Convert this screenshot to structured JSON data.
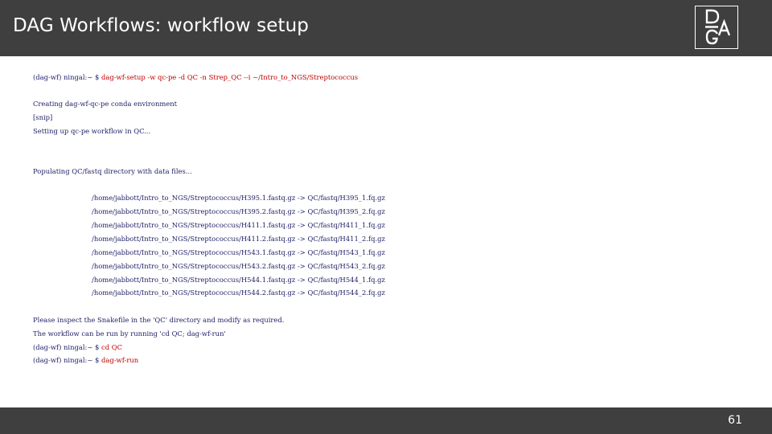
{
  "header": {
    "title": "DAG Workflows: workflow setup",
    "logo_text": "DAG"
  },
  "terminal": {
    "prompt1": "(dag-wf) ningal:~ $",
    "command1": "dag-wf-setup -w qc-pe -d QC -n Strep_QC --i ~/Intro_to_NGS/Streptococcus",
    "output_lines": [
      "Creating dag-wf-qc-pe conda environment",
      "[snip]",
      "Setting up qc-pe workflow in QC..."
    ],
    "populating": "Populating QC/fastq directory with data files...",
    "file_mappings": [
      "/home/jabbott/Intro_to_NGS/Streptococcus/H395.1.fastq.gz -> QC/fastq/H395_1.fq.gz",
      "/home/jabbott/Intro_to_NGS/Streptococcus/H395.2.fastq.gz -> QC/fastq/H395_2.fq.gz",
      "/home/jabbott/Intro_to_NGS/Streptococcus/H411.1.fastq.gz -> QC/fastq/H411_1.fq.gz",
      "/home/jabbott/Intro_to_NGS/Streptococcus/H411.2.fastq.gz -> QC/fastq/H411_2.fq.gz",
      "/home/jabbott/Intro_to_NGS/Streptococcus/H543.1.fastq.gz -> QC/fastq/H543_1.fq.gz",
      "/home/jabbott/Intro_to_NGS/Streptococcus/H543.2.fastq.gz -> QC/fastq/H543_2.fq.gz",
      "/home/jabbott/Intro_to_NGS/Streptococcus/H544.1.fastq.gz -> QC/fastq/H544_1.fq.gz",
      "/home/jabbott/Intro_to_NGS/Streptococcus/H544.2.fastq.gz -> QC/fastq/H544_2.fq.gz"
    ],
    "inspect_line": "Please inspect the Snakefile in the 'QC' directory and modify as required.",
    "run_hint": "The workflow can be run by running 'cd QC; dag-wf-run'",
    "prompt2": "(dag-wf) ningal:~ $",
    "command2": "cd QC",
    "prompt3": "(dag-wf) ningal:~ $",
    "command3": "dag-wf-run"
  },
  "footer": {
    "page_number": "61"
  },
  "colors": {
    "header_bg": "#3f3f3f",
    "prompt_text": "#1e1e66",
    "command_text": "#c00000"
  }
}
